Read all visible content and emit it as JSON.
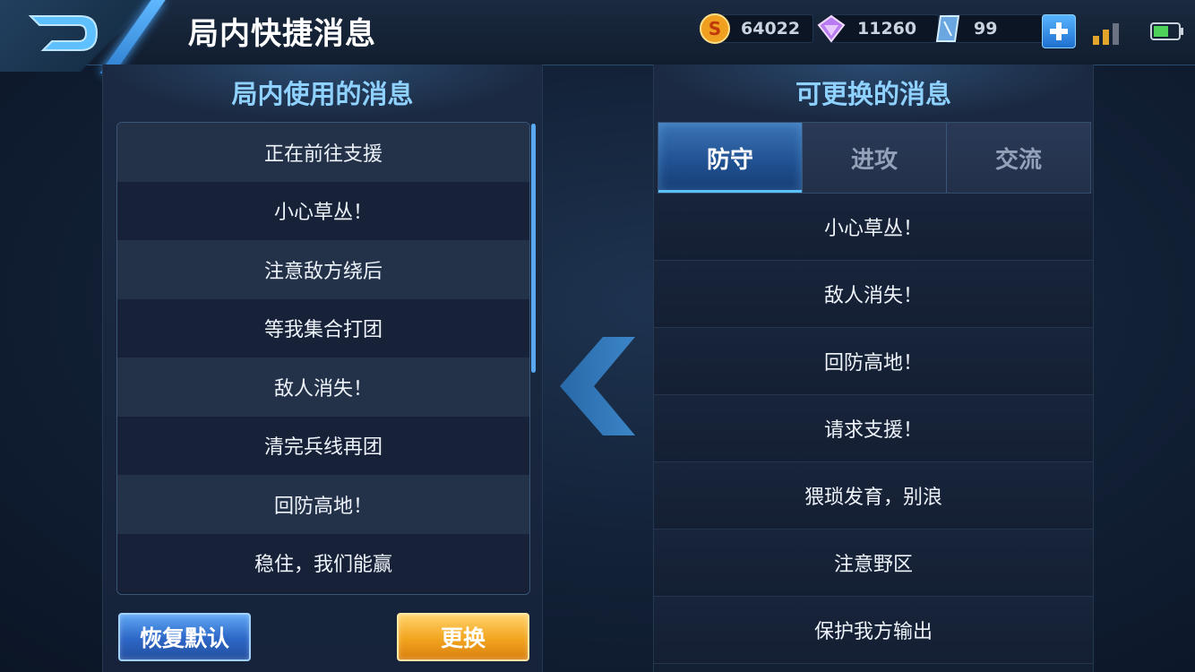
{
  "header": {
    "title": "局内快捷消息",
    "currencies": [
      {
        "icon": "gold-coin-icon",
        "value": "64022"
      },
      {
        "icon": "diamond-icon",
        "value": "11260"
      },
      {
        "icon": "crystal-ticket-icon",
        "value": "99"
      }
    ]
  },
  "left_panel": {
    "title": "局内使用的消息",
    "items": [
      "正在前往支援",
      "小心草丛！",
      "注意敌方绕后",
      "等我集合打团",
      "敌人消失！",
      "清完兵线再团",
      "回防高地！",
      "稳住，我们能赢"
    ],
    "reset_label": "恢复默认",
    "swap_label": "更换"
  },
  "right_panel": {
    "title": "可更换的消息",
    "tabs": [
      "防守",
      "进攻",
      "交流"
    ],
    "active_tab": "防守",
    "items": [
      "小心草丛！",
      "敌人消失！",
      "回防高地！",
      "请求支援！",
      "猥琐发育，别浪",
      "注意野区",
      "保护我方输出"
    ]
  },
  "colors": {
    "accent_blue": "#8fd2ff",
    "gold_button": "#f2a41e",
    "blue_button": "#2c66c6"
  }
}
